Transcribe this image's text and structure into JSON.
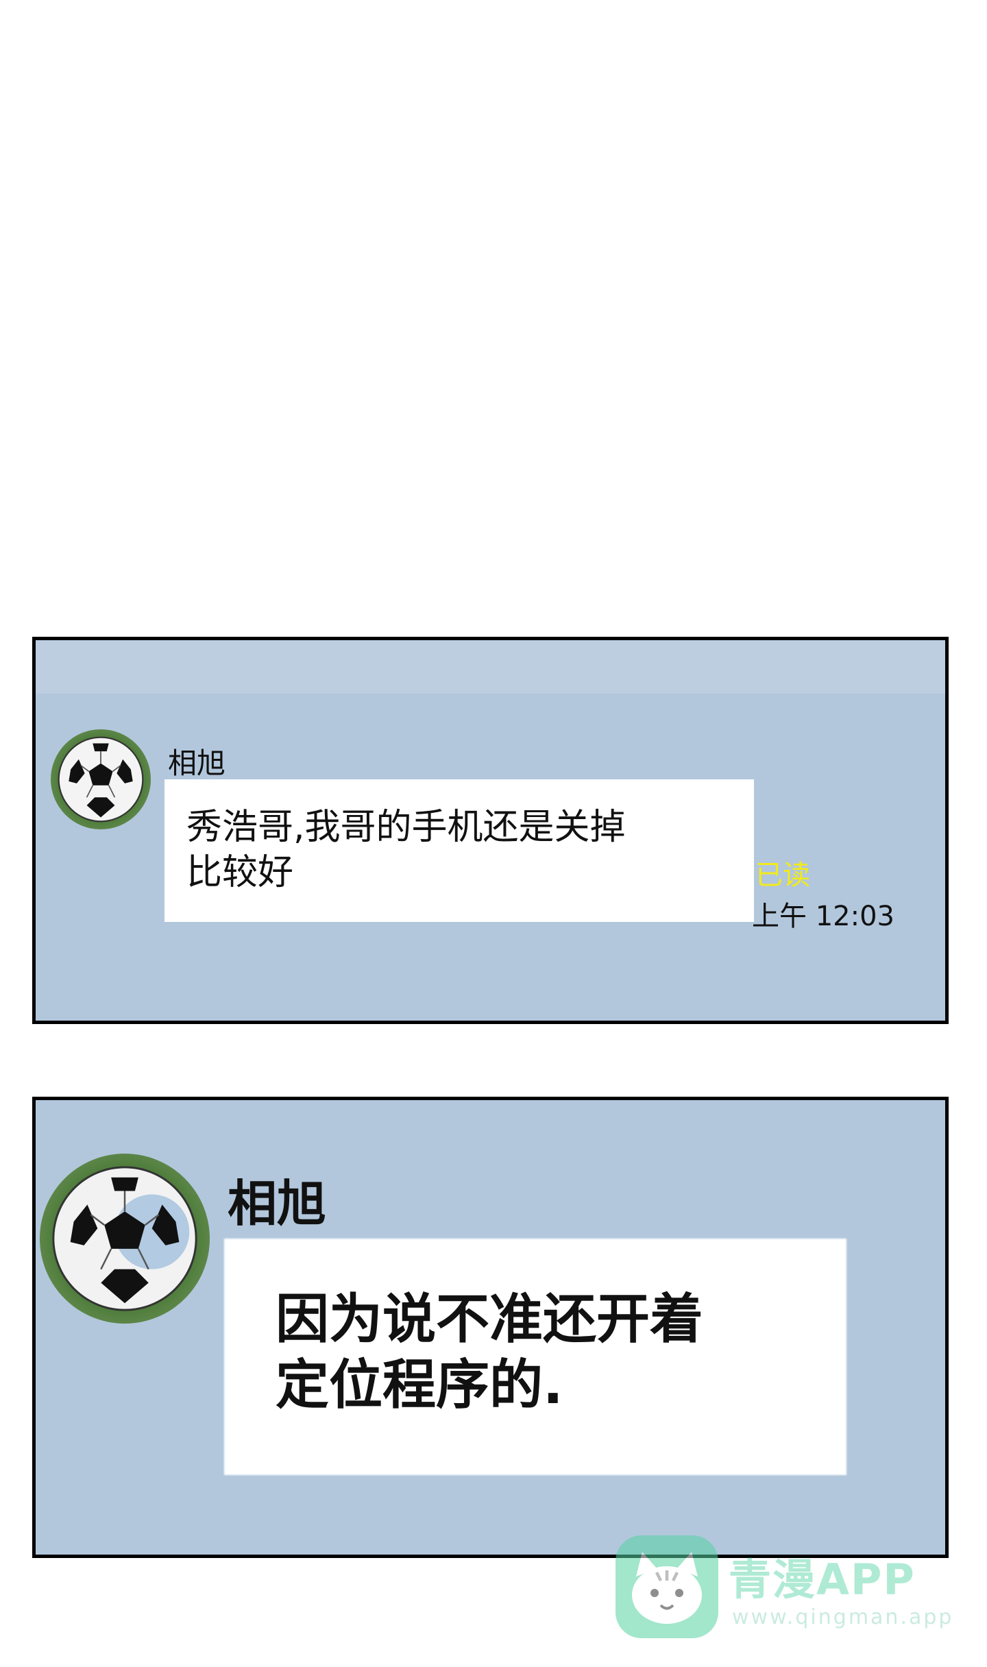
{
  "panels": [
    {
      "sender": "相旭",
      "message": "秀浩哥,我哥的手机还是关掉\n比较好",
      "read_status": "已读",
      "time": "上午 12:03",
      "avatar_icon": "soccer-ball-icon"
    },
    {
      "sender": "相旭",
      "message": "因为说不准还开着\n定位程序的."
    }
  ],
  "watermark": {
    "title": "青漫APP",
    "url": "www.qingman.app",
    "icon": "cat-logo-icon"
  },
  "colors": {
    "panel_bg": "#b2c7dc",
    "read_status": "#f2ea1a",
    "watermark": "#57d3a2"
  }
}
